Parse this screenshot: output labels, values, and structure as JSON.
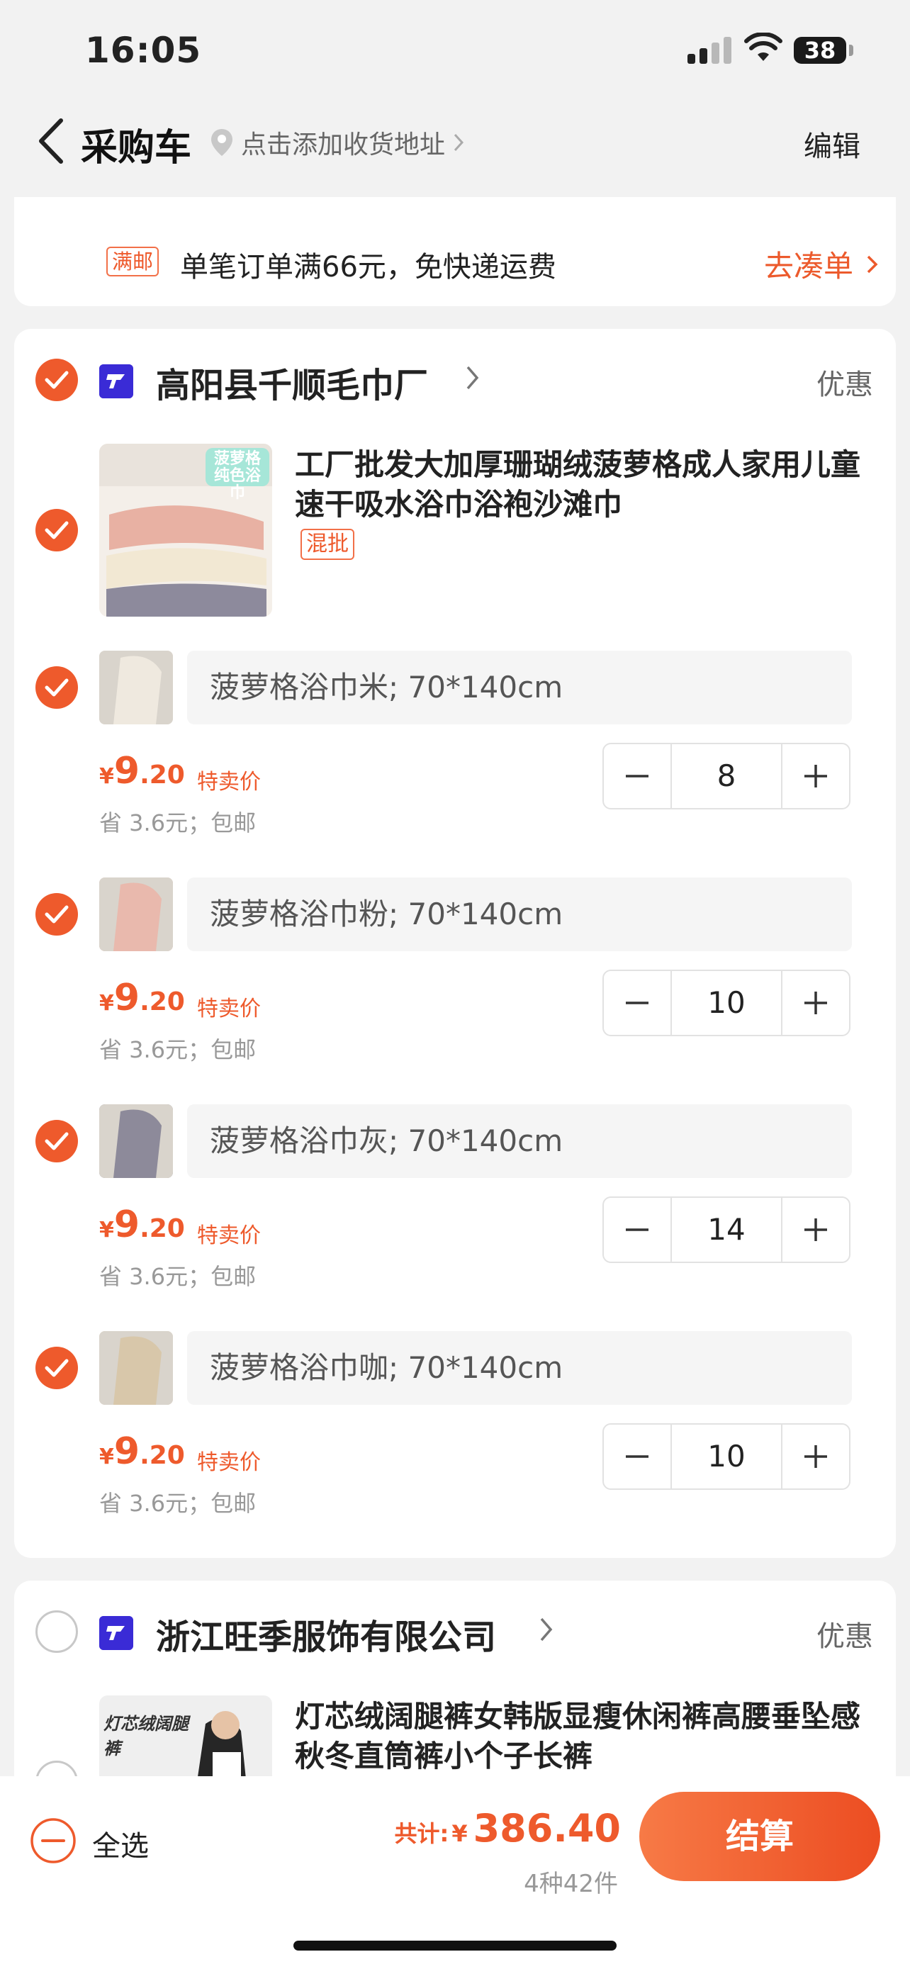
{
  "status_bar": {
    "time": "16:05",
    "battery": "38"
  },
  "nav": {
    "title": "采购车",
    "address_prompt": "点击添加收货地址",
    "edit": "编辑"
  },
  "shipping": {
    "badge": "满邮",
    "text": "单笔订单满66元，免快递运费",
    "link": "去凑单"
  },
  "stores": [
    {
      "name": "高阳县千顺毛巾厂",
      "promo": "优惠",
      "product": {
        "title": "工厂批发大加厚珊瑚绒菠萝格成人家用儿童速干吸水浴巾浴袍沙滩巾",
        "tag": "混批",
        "image_caption": "菠萝格纯色浴巾"
      },
      "skus": [
        {
          "spec": "菠萝格浴巾米; 70*140cm",
          "currency": "¥",
          "price_int": "9",
          "price_dec": ".20",
          "price_tag": "特卖价",
          "save": "省 3.6元；包邮",
          "qty": "8",
          "color": "#efe9df"
        },
        {
          "spec": "菠萝格浴巾粉; 70*140cm",
          "currency": "¥",
          "price_int": "9",
          "price_dec": ".20",
          "price_tag": "特卖价",
          "save": "省 3.6元；包邮",
          "qty": "10",
          "color": "#e9b9ad"
        },
        {
          "spec": "菠萝格浴巾灰; 70*140cm",
          "currency": "¥",
          "price_int": "9",
          "price_dec": ".20",
          "price_tag": "特卖价",
          "save": "省 3.6元；包邮",
          "qty": "14",
          "color": "#8d8a9a"
        },
        {
          "spec": "菠萝格浴巾咖; 70*140cm",
          "currency": "¥",
          "price_int": "9",
          "price_dec": ".20",
          "price_tag": "特卖价",
          "save": "省 3.6元；包邮",
          "qty": "10",
          "color": "#d8c7aa"
        }
      ]
    },
    {
      "name": "浙江旺季服饰有限公司",
      "promo": "优惠",
      "product": {
        "title": "灯芯绒阔腿裤女韩版显瘦休闲裤高腰垂坠感秋冬直筒裤小个子长裤",
        "image_caption": "灯芯绒阔腿裤"
      }
    }
  ],
  "footer": {
    "select_all": "全选",
    "total_label": "共计:",
    "currency": "¥",
    "total": "386.40",
    "count": "4种42件",
    "checkout": "结算"
  },
  "colors": {
    "accent": "#ee5a2c",
    "store_logo": "#3a2bd6"
  },
  "icons": [
    "back-icon",
    "location-pin-icon",
    "chevron-right-icon",
    "check-icon",
    "store-logo-icon",
    "minus-icon",
    "plus-icon",
    "signal-icon",
    "wifi-icon",
    "battery-icon"
  ]
}
